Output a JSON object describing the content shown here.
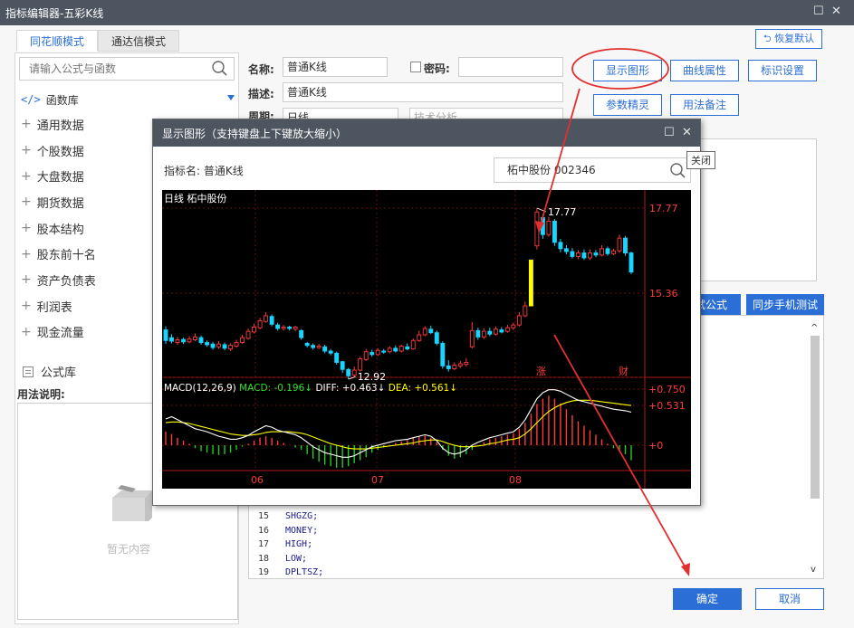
{
  "window": {
    "title": "指标编辑器-五彩K线"
  },
  "tabs": [
    {
      "label": "同花顺模式"
    },
    {
      "label": "通达信模式"
    }
  ],
  "restore_button": "恢复默认",
  "left": {
    "search_placeholder": "请输入公式与函数",
    "library": "函数库",
    "tree": [
      "通用数据",
      "个股数据",
      "大盘数据",
      "期货数据",
      "股本结构",
      "股东前十名",
      "资产负债表",
      "利润表",
      "现金流量"
    ],
    "formula_lib": "公式库",
    "usage_title": "用法说明:",
    "empty": "暂无内容"
  },
  "form": {
    "name_label": "名称:",
    "name_value": "普通K线",
    "password_label": "密码:",
    "desc_label": "描述:",
    "desc_value": "普通K线",
    "period_label": "周期:",
    "period_value": "日线",
    "category_value": "技术分析"
  },
  "buttons": {
    "show_chart": "显示图形",
    "line_props": "曲线属性",
    "mark_settings": "标识设置",
    "param_wizard": "参数精灵",
    "usage_note": "用法备注",
    "test_formula": "测试公式",
    "sync_mobile": "同步手机测试",
    "ok": "确定",
    "cancel": "取消"
  },
  "code": [
    {
      "n": "15",
      "c": "SHGZG;"
    },
    {
      "n": "16",
      "c": "MONEY;"
    },
    {
      "n": "17",
      "c": "HIGH;"
    },
    {
      "n": "18",
      "c": "LOW;"
    },
    {
      "n": "19",
      "c": "DPLTSZ;"
    }
  ],
  "modal": {
    "title": "显示图形（支持键盘上下键放大缩小）",
    "indicator_label": "指标名:",
    "indicator_value": "普通K线",
    "stock": "柘中股份 002346",
    "tooltip": "关闭"
  },
  "chart_data": {
    "type": "candlestick",
    "title": "日线  柘中股份",
    "price_labels": [
      "17.77",
      "15.36"
    ],
    "high_mark": "17.77",
    "low_mark": "12.92",
    "markers": [
      "涨",
      "财"
    ],
    "x_ticks": [
      "06",
      "07",
      "08"
    ],
    "macd_header": "MACD(12,26,9)",
    "macd": "MACD: -0.196↓",
    "diff": "DIFF: +0.463↓",
    "dea": "DEA: +0.561↓",
    "macd_ticks": [
      "+0.750",
      "+0.531",
      "+0"
    ],
    "colors": {
      "up": "#ff3b3b",
      "down": "#18d4ff",
      "limit": "#ffff00",
      "diff": "#ffffff",
      "dea": "#ffff00",
      "bar_pos": "#ff3b3b",
      "bar_neg": "#22cc22"
    }
  }
}
